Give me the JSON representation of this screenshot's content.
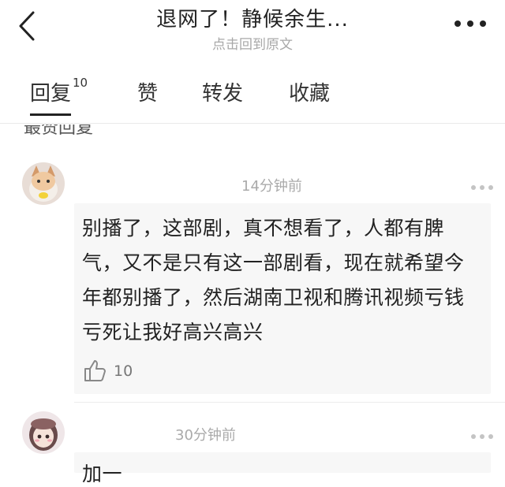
{
  "header": {
    "title": "退网了！静候余生...",
    "subtitle": "点击回到原文",
    "back_icon": "chevron-left-icon",
    "more_icon": "more-dots-icon"
  },
  "tabs": [
    {
      "label": "回复",
      "count": "10",
      "active": true
    },
    {
      "label": "赞"
    },
    {
      "label": "转发"
    },
    {
      "label": "收藏"
    }
  ],
  "partial_section_label": "最赞回复",
  "comments": [
    {
      "time": "14分钟前",
      "lines": [
        "别播了，这部剧，真不想看了，人都有脾",
        "气，又不是只有这一部剧看，现在就希望今",
        "年都别播了，然后湖南卫视和腾讯视频亏钱",
        "亏死让我好高兴高兴"
      ],
      "likes": "10"
    },
    {
      "time": "30分钟前",
      "lines": [
        "加一"
      ]
    }
  ],
  "colors": {
    "text": "#222222",
    "muted": "#a8a8a8",
    "card_bg": "#f7f7f7",
    "divider": "#ececec"
  }
}
